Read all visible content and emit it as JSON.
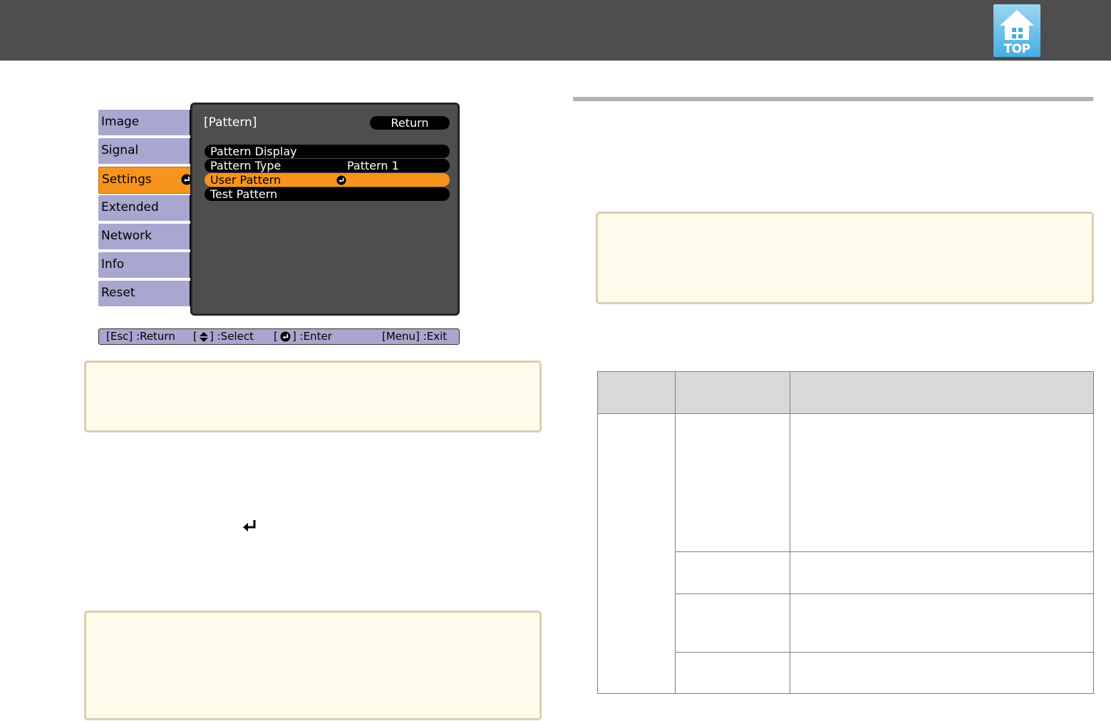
{
  "header": {
    "top_button_label": "TOP"
  },
  "menu": {
    "sidebar": [
      {
        "label": "Image"
      },
      {
        "label": "Signal"
      },
      {
        "label": "Settings"
      },
      {
        "label": "Extended"
      },
      {
        "label": "Network"
      },
      {
        "label": "Info"
      },
      {
        "label": "Reset"
      }
    ],
    "active_sidebar_index": 2,
    "panel_title": "[Pattern]",
    "return_label": "Return",
    "options": [
      {
        "label": "Pattern Display",
        "value": ""
      },
      {
        "label": "Pattern Type",
        "value": "Pattern 1"
      },
      {
        "label": "User Pattern",
        "value": ""
      },
      {
        "label": "Test Pattern",
        "value": ""
      }
    ],
    "selected_option_index": 2,
    "help": {
      "esc": "[Esc] :Return",
      "select_open": "[",
      "select_close": "] :Select",
      "enter_open": "[",
      "enter_close": "] :Enter",
      "menu": "[Menu] :Exit"
    }
  },
  "colors": {
    "header_bg": "#4d4d4d",
    "menu_highlight": "#f7941d",
    "sidebar_item": "#a9a6cf",
    "panel_bg": "#4e4e4e",
    "note_bg": "#fffbeb",
    "table_header_bg": "#d9d9d9",
    "rule": "#b3b3b3"
  },
  "icons": {
    "top": "home-top-icon",
    "enter": "enter-icon",
    "updown": "up-down-arrow-icon"
  }
}
